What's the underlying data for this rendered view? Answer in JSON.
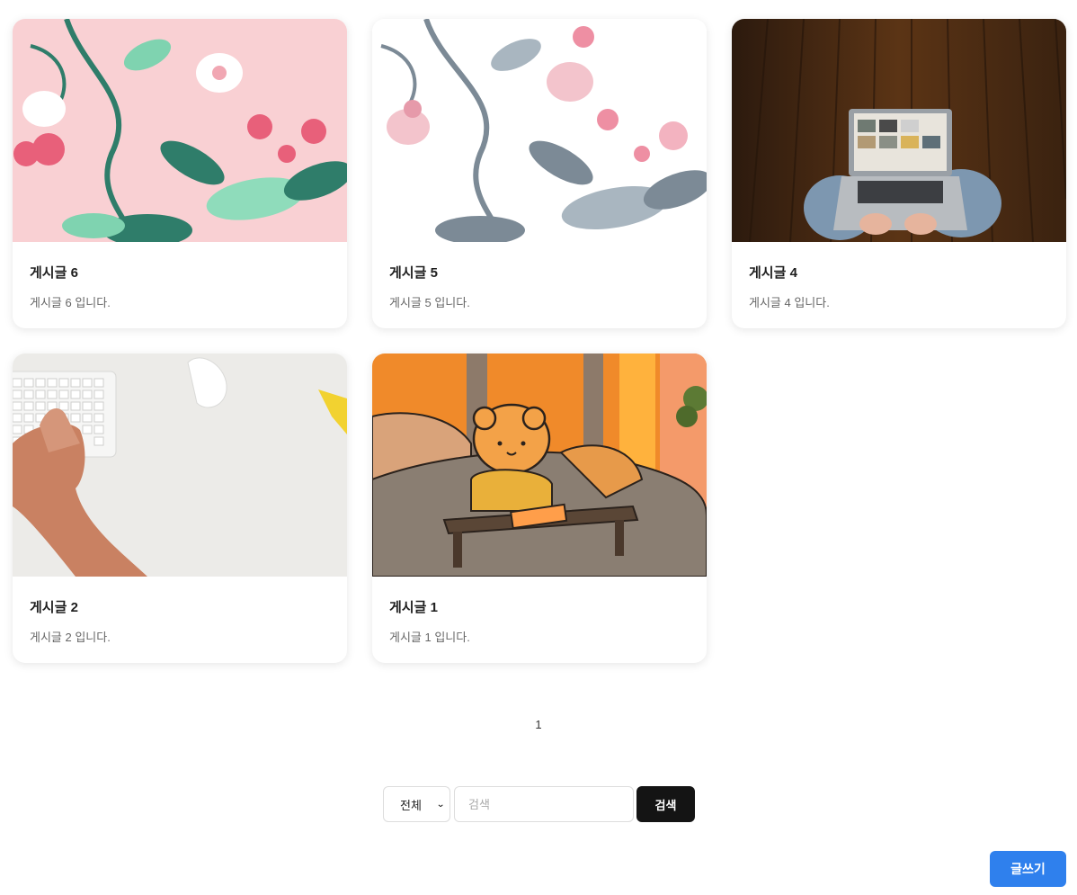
{
  "posts": [
    {
      "title": "게시글 6",
      "desc": "게시글 6 입니다.",
      "image": "floral-pattern-pink"
    },
    {
      "title": "게시글 5",
      "desc": "게시글 5 입니다.",
      "image": "floral-pattern-white"
    },
    {
      "title": "게시글 4",
      "desc": "게시글 4 입니다.",
      "image": "laptop-on-wood-floor"
    },
    {
      "title": "게시글 2",
      "desc": "게시글 2 입니다.",
      "image": "hand-on-keyboard"
    },
    {
      "title": "게시글 1",
      "desc": "게시글 1 입니다.",
      "image": "bear-illustration"
    }
  ],
  "pagination": {
    "current": "1"
  },
  "search": {
    "scope": "전체",
    "placeholder": "검색",
    "value": "",
    "button": "검색"
  },
  "write_button": "글쓰기",
  "colors": {
    "primary": "#2f80ed",
    "dark_button": "#141414"
  }
}
